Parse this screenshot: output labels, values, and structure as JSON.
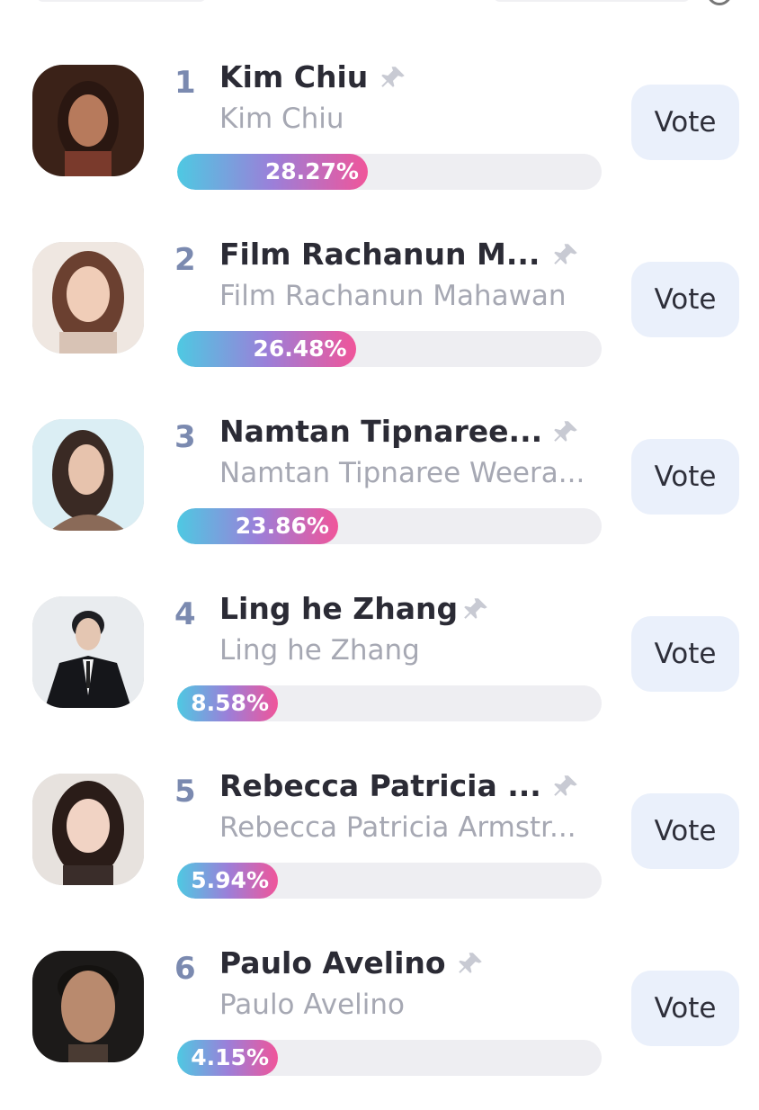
{
  "icons": {
    "pin": "pin-icon",
    "info": "info-icon"
  },
  "colors": {
    "accent_start": "#4ec9e2",
    "accent_mid": "#9b7fd9",
    "accent_end": "#f0559a",
    "vote_bg": "#eaf0fb"
  },
  "vote_label": "Vote",
  "entries": [
    {
      "rank": "1",
      "name": "Kim Chiu",
      "subtitle": "Kim Chiu",
      "percent": 28.27,
      "percent_label": "28.27%"
    },
    {
      "rank": "2",
      "name": "Film Rachanun M...",
      "subtitle": "Film Rachanun Mahawan",
      "percent": 26.48,
      "percent_label": "26.48%"
    },
    {
      "rank": "3",
      "name": "Namtan Tipnaree...",
      "subtitle": "Namtan Tipnaree Weera...",
      "percent": 23.86,
      "percent_label": "23.86%"
    },
    {
      "rank": "4",
      "name": "Ling he Zhang",
      "subtitle": "Ling he Zhang",
      "percent": 8.58,
      "percent_label": "8.58%"
    },
    {
      "rank": "5",
      "name": "Rebecca Patricia ...",
      "subtitle": "Rebecca Patricia Armstr...",
      "percent": 5.94,
      "percent_label": "5.94%"
    },
    {
      "rank": "6",
      "name": "Paulo Avelino",
      "subtitle": "Paulo Avelino",
      "percent": 4.15,
      "percent_label": "4.15%"
    }
  ]
}
